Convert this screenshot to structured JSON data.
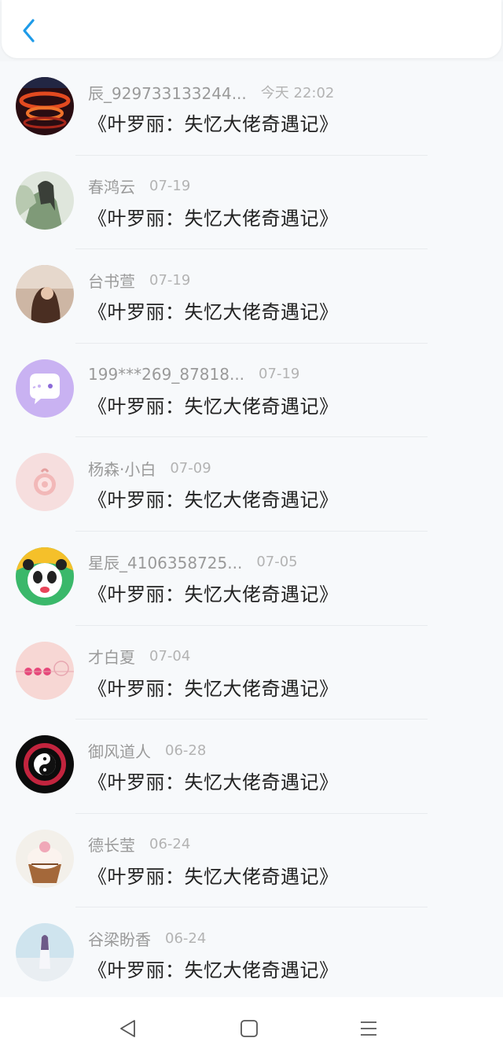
{
  "app": {
    "accent": "#1e9be8"
  },
  "header": {
    "back_icon": "chevron-left-icon"
  },
  "items": [
    {
      "name": "辰_929733133244...",
      "time": "今天 22:02",
      "title": "《叶罗丽：失忆大佬奇遇记》"
    },
    {
      "name": "春鸿云",
      "time": "07-19",
      "title": "《叶罗丽：失忆大佬奇遇记》"
    },
    {
      "name": "台书萱",
      "time": "07-19",
      "title": "《叶罗丽：失忆大佬奇遇记》"
    },
    {
      "name": "199***269_87818...",
      "time": "07-19",
      "title": "《叶罗丽：失忆大佬奇遇记》"
    },
    {
      "name": "杨森·小白",
      "time": "07-09",
      "title": "《叶罗丽：失忆大佬奇遇记》"
    },
    {
      "name": "星辰_4106358725...",
      "time": "07-05",
      "title": "《叶罗丽：失忆大佬奇遇记》"
    },
    {
      "name": "才白夏",
      "time": "07-04",
      "title": "《叶罗丽：失忆大佬奇遇记》"
    },
    {
      "name": "御风道人",
      "time": "06-28",
      "title": "《叶罗丽：失忆大佬奇遇记》"
    },
    {
      "name": "德长莹",
      "time": "06-24",
      "title": "《叶罗丽：失忆大佬奇遇记》"
    },
    {
      "name": "谷梁盼香",
      "time": "06-24",
      "title": "《叶罗丽：失忆大佬奇遇记》"
    }
  ],
  "navbar": {
    "back": "triangle-back-icon",
    "home": "square-home-icon",
    "menu": "menu-lines-icon"
  }
}
